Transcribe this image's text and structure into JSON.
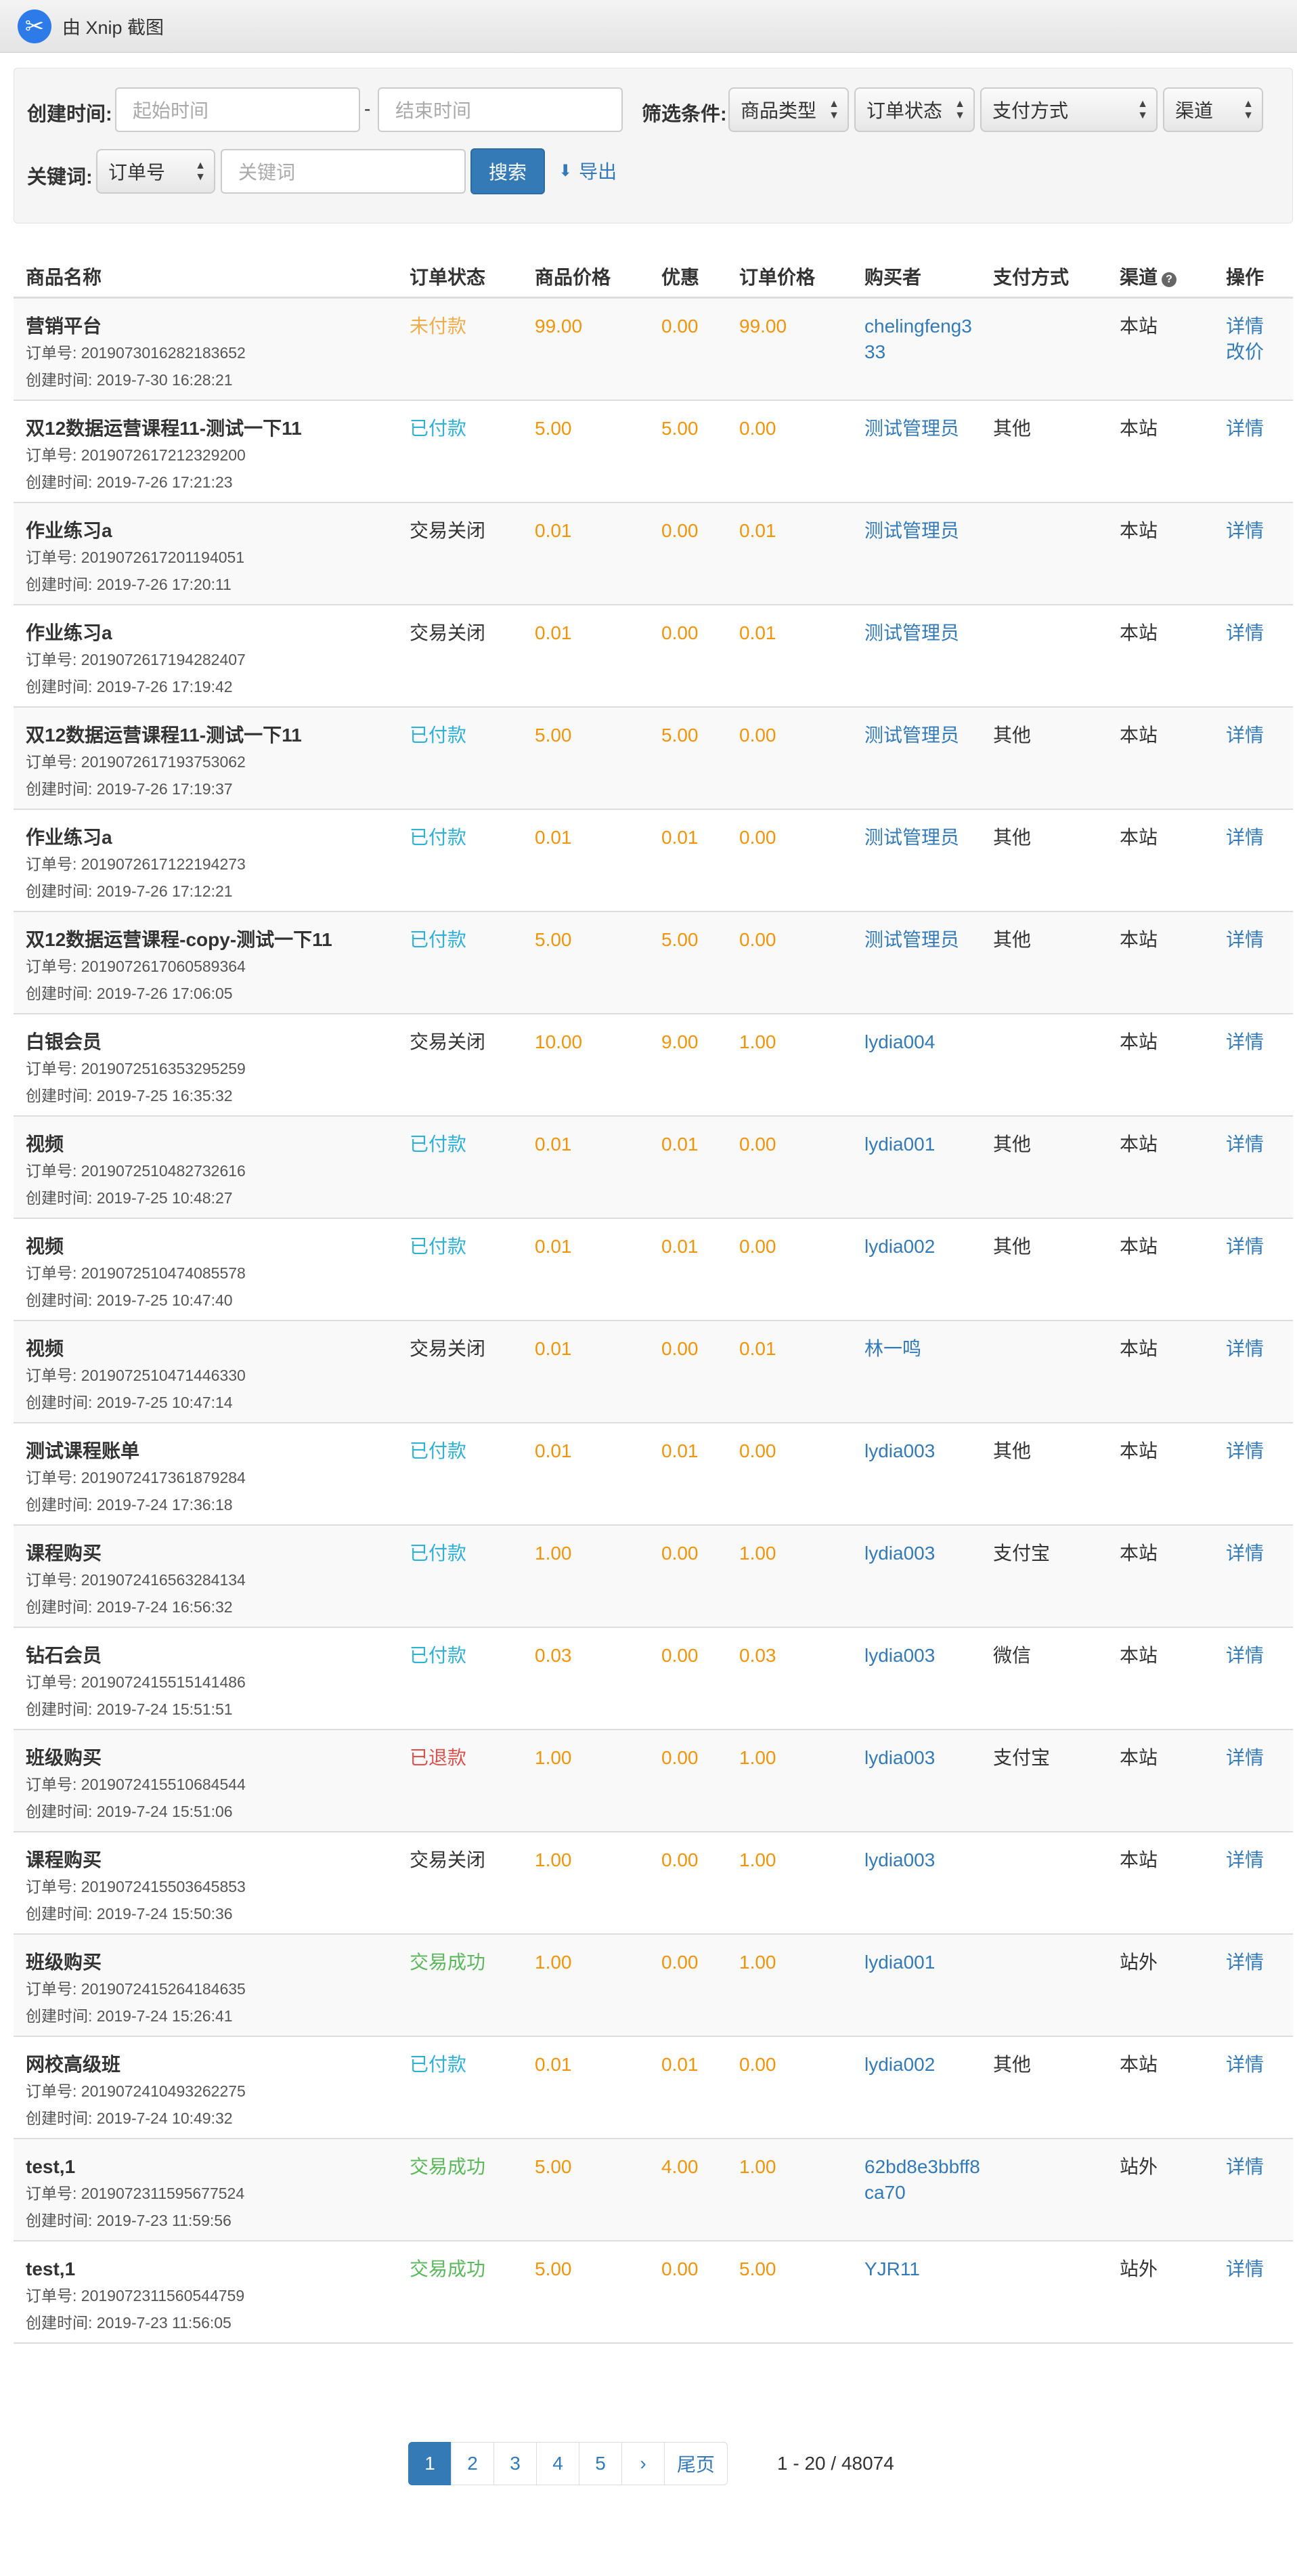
{
  "xnip": {
    "title": "由 Xnip 截图",
    "icon": "scissors-icon"
  },
  "filters": {
    "created_label": "创建时间:",
    "start_placeholder": "起始时间",
    "separator": "-",
    "end_placeholder": "结束时间",
    "filter_label": "筛选条件:",
    "product_type": "商品类型",
    "order_status": "订单状态",
    "pay_method": "支付方式",
    "channel": "渠道",
    "keyword_label": "关键词:",
    "keyword_type": "订单号",
    "keyword_placeholder": "关键词",
    "search_button": "搜索",
    "export_button": "导出"
  },
  "table": {
    "headers": [
      "商品名称",
      "订单状态",
      "商品价格",
      "优惠",
      "订单价格",
      "购买者",
      "支付方式",
      "渠道",
      "操作"
    ],
    "order_no_prefix": "订单号:",
    "created_prefix": "创建时间:",
    "rows": [
      {
        "name": "营销平台",
        "order_no": "2019073016282183652",
        "created": "2019-7-30 16:28:21",
        "status": "未付款",
        "status_type": "unpaid",
        "price": "99.00",
        "discount": "0.00",
        "total": "99.00",
        "buyer": "chelingfeng333",
        "pay": "",
        "channel": "本站",
        "actions": [
          "详情",
          "改价"
        ]
      },
      {
        "name": "双12数据运营课程11-测试一下11",
        "order_no": "2019072617212329200",
        "created": "2019-7-26 17:21:23",
        "status": "已付款",
        "status_type": "paid",
        "price": "5.00",
        "discount": "5.00",
        "total": "0.00",
        "buyer": "测试管理员",
        "pay": "其他",
        "channel": "本站",
        "actions": [
          "详情"
        ]
      },
      {
        "name": "作业练习a",
        "order_no": "2019072617201194051",
        "created": "2019-7-26 17:20:11",
        "status": "交易关闭",
        "status_type": "closed",
        "price": "0.01",
        "discount": "0.00",
        "total": "0.01",
        "buyer": "测试管理员",
        "pay": "",
        "channel": "本站",
        "actions": [
          "详情"
        ]
      },
      {
        "name": "作业练习a",
        "order_no": "2019072617194282407",
        "created": "2019-7-26 17:19:42",
        "status": "交易关闭",
        "status_type": "closed",
        "price": "0.01",
        "discount": "0.00",
        "total": "0.01",
        "buyer": "测试管理员",
        "pay": "",
        "channel": "本站",
        "actions": [
          "详情"
        ]
      },
      {
        "name": "双12数据运营课程11-测试一下11",
        "order_no": "2019072617193753062",
        "created": "2019-7-26 17:19:37",
        "status": "已付款",
        "status_type": "paid",
        "price": "5.00",
        "discount": "5.00",
        "total": "0.00",
        "buyer": "测试管理员",
        "pay": "其他",
        "channel": "本站",
        "actions": [
          "详情"
        ]
      },
      {
        "name": "作业练习a",
        "order_no": "2019072617122194273",
        "created": "2019-7-26 17:12:21",
        "status": "已付款",
        "status_type": "paid",
        "price": "0.01",
        "discount": "0.01",
        "total": "0.00",
        "buyer": "测试管理员",
        "pay": "其他",
        "channel": "本站",
        "actions": [
          "详情"
        ]
      },
      {
        "name": "双12数据运营课程-copy-测试一下11",
        "order_no": "2019072617060589364",
        "created": "2019-7-26 17:06:05",
        "status": "已付款",
        "status_type": "paid",
        "price": "5.00",
        "discount": "5.00",
        "total": "0.00",
        "buyer": "测试管理员",
        "pay": "其他",
        "channel": "本站",
        "actions": [
          "详情"
        ]
      },
      {
        "name": "白银会员",
        "order_no": "2019072516353295259",
        "created": "2019-7-25 16:35:32",
        "status": "交易关闭",
        "status_type": "closed",
        "price": "10.00",
        "discount": "9.00",
        "total": "1.00",
        "buyer": "lydia004",
        "pay": "",
        "channel": "本站",
        "actions": [
          "详情"
        ]
      },
      {
        "name": "视频",
        "order_no": "2019072510482732616",
        "created": "2019-7-25 10:48:27",
        "status": "已付款",
        "status_type": "paid",
        "price": "0.01",
        "discount": "0.01",
        "total": "0.00",
        "buyer": "lydia001",
        "pay": "其他",
        "channel": "本站",
        "actions": [
          "详情"
        ]
      },
      {
        "name": "视频",
        "order_no": "2019072510474085578",
        "created": "2019-7-25 10:47:40",
        "status": "已付款",
        "status_type": "paid",
        "price": "0.01",
        "discount": "0.01",
        "total": "0.00",
        "buyer": "lydia002",
        "pay": "其他",
        "channel": "本站",
        "actions": [
          "详情"
        ]
      },
      {
        "name": "视频",
        "order_no": "2019072510471446330",
        "created": "2019-7-25 10:47:14",
        "status": "交易关闭",
        "status_type": "closed",
        "price": "0.01",
        "discount": "0.00",
        "total": "0.01",
        "buyer": "林一鸣",
        "pay": "",
        "channel": "本站",
        "actions": [
          "详情"
        ]
      },
      {
        "name": "测试课程账单",
        "order_no": "2019072417361879284",
        "created": "2019-7-24 17:36:18",
        "status": "已付款",
        "status_type": "paid",
        "price": "0.01",
        "discount": "0.01",
        "total": "0.00",
        "buyer": "lydia003",
        "pay": "其他",
        "channel": "本站",
        "actions": [
          "详情"
        ]
      },
      {
        "name": "课程购买",
        "order_no": "2019072416563284134",
        "created": "2019-7-24 16:56:32",
        "status": "已付款",
        "status_type": "paid",
        "price": "1.00",
        "discount": "0.00",
        "total": "1.00",
        "buyer": "lydia003",
        "pay": "支付宝",
        "channel": "本站",
        "actions": [
          "详情"
        ]
      },
      {
        "name": "钻石会员",
        "order_no": "2019072415515141486",
        "created": "2019-7-24 15:51:51",
        "status": "已付款",
        "status_type": "paid",
        "price": "0.03",
        "discount": "0.00",
        "total": "0.03",
        "buyer": "lydia003",
        "pay": "微信",
        "channel": "本站",
        "actions": [
          "详情"
        ]
      },
      {
        "name": "班级购买",
        "order_no": "2019072415510684544",
        "created": "2019-7-24 15:51:06",
        "status": "已退款",
        "status_type": "refund",
        "price": "1.00",
        "discount": "0.00",
        "total": "1.00",
        "buyer": "lydia003",
        "pay": "支付宝",
        "channel": "本站",
        "actions": [
          "详情"
        ]
      },
      {
        "name": "课程购买",
        "order_no": "2019072415503645853",
        "created": "2019-7-24 15:50:36",
        "status": "交易关闭",
        "status_type": "closed",
        "price": "1.00",
        "discount": "0.00",
        "total": "1.00",
        "buyer": "lydia003",
        "pay": "",
        "channel": "本站",
        "actions": [
          "详情"
        ]
      },
      {
        "name": "班级购买",
        "order_no": "2019072415264184635",
        "created": "2019-7-24 15:26:41",
        "status": "交易成功",
        "status_type": "success",
        "price": "1.00",
        "discount": "0.00",
        "total": "1.00",
        "buyer": "lydia001",
        "pay": "",
        "channel": "站外",
        "actions": [
          "详情"
        ]
      },
      {
        "name": "网校高级班",
        "order_no": "2019072410493262275",
        "created": "2019-7-24 10:49:32",
        "status": "已付款",
        "status_type": "paid",
        "price": "0.01",
        "discount": "0.01",
        "total": "0.00",
        "buyer": "lydia002",
        "pay": "其他",
        "channel": "本站",
        "actions": [
          "详情"
        ]
      },
      {
        "name": "test,1",
        "order_no": "2019072311595677524",
        "created": "2019-7-23 11:59:56",
        "status": "交易成功",
        "status_type": "success",
        "price": "5.00",
        "discount": "4.00",
        "total": "1.00",
        "buyer": "62bd8e3bbff8ca70",
        "pay": "",
        "channel": "站外",
        "actions": [
          "详情"
        ]
      },
      {
        "name": "test,1",
        "order_no": "2019072311560544759",
        "created": "2019-7-23 11:56:05",
        "status": "交易成功",
        "status_type": "success",
        "price": "5.00",
        "discount": "0.00",
        "total": "5.00",
        "buyer": "YJR11",
        "pay": "",
        "channel": "站外",
        "actions": [
          "详情"
        ]
      }
    ]
  },
  "pagination": {
    "pages": [
      "1",
      "2",
      "3",
      "4",
      "5"
    ],
    "current": "1",
    "next": "›",
    "last": "尾页",
    "info": "1 - 20 / 48074"
  },
  "colors": {
    "primary": "#337ab7",
    "orange": "#f0950b",
    "paid": "#31b0d5",
    "unpaid": "#f0ad4e",
    "refund": "#d9534f",
    "success": "#5cb85c"
  }
}
